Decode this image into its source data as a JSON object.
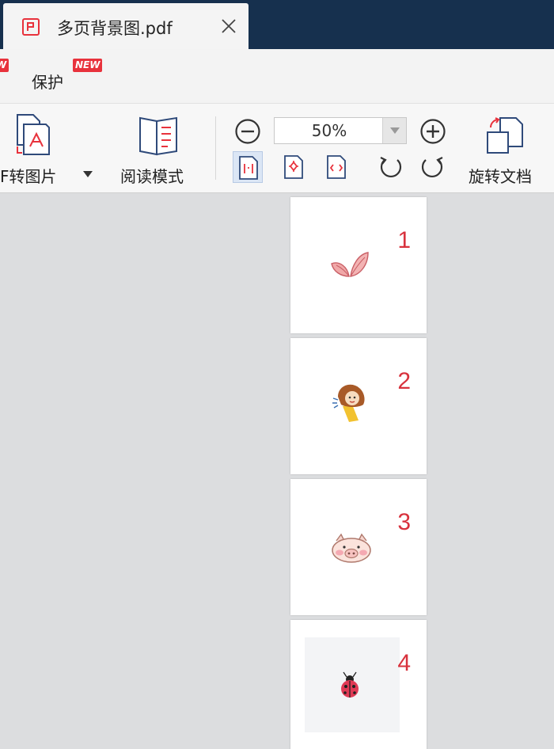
{
  "tab": {
    "title": "多页背景图.pdf"
  },
  "menubar": {
    "left_badge": "W",
    "protect_label": "保护",
    "protect_badge": "NEW"
  },
  "toolbar": {
    "pdf_to_image_label": "F转图片",
    "reading_mode_label": "阅读模式",
    "zoom_value": "50%",
    "rotate_doc_label": "旋转文档"
  },
  "pages": [
    {
      "number": "1",
      "art": "leaf-sprout-icon"
    },
    {
      "number": "2",
      "art": "running-girl-icon"
    },
    {
      "number": "3",
      "art": "pig-face-icon"
    },
    {
      "number": "4",
      "art": "ladybug-icon"
    }
  ],
  "colors": {
    "titlebar": "#16304e",
    "accent_red": "#e8323c",
    "page_number": "#d8323d",
    "canvas": "#dcdddf"
  }
}
